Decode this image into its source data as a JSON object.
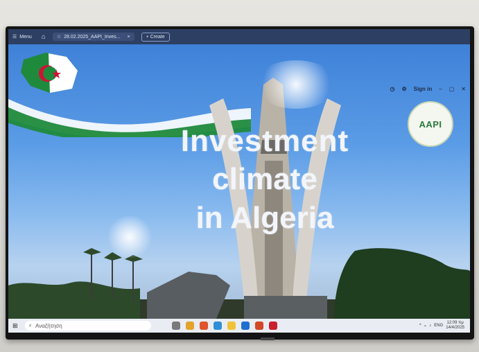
{
  "browser": {
    "menu_label": "Menu",
    "tab_title": "28.02.2025_AAPI_Inves...",
    "tab_close": "×",
    "create_label": "+ Create",
    "sign_in": "Sign in"
  },
  "slide": {
    "line1": "Investment",
    "line2": "climate",
    "line3": "in Algeria",
    "logo_text": "AAPI"
  },
  "taskbar": {
    "search_placeholder": "Αναζήτηση",
    "language": "ENG",
    "time": "12:09 πμ",
    "date": "14/4/2025"
  },
  "colors": {
    "flag_green": "#1f8a3c",
    "flag_white": "#ffffff",
    "flag_red": "#d21034",
    "browser_bar": "#2d3f63"
  }
}
